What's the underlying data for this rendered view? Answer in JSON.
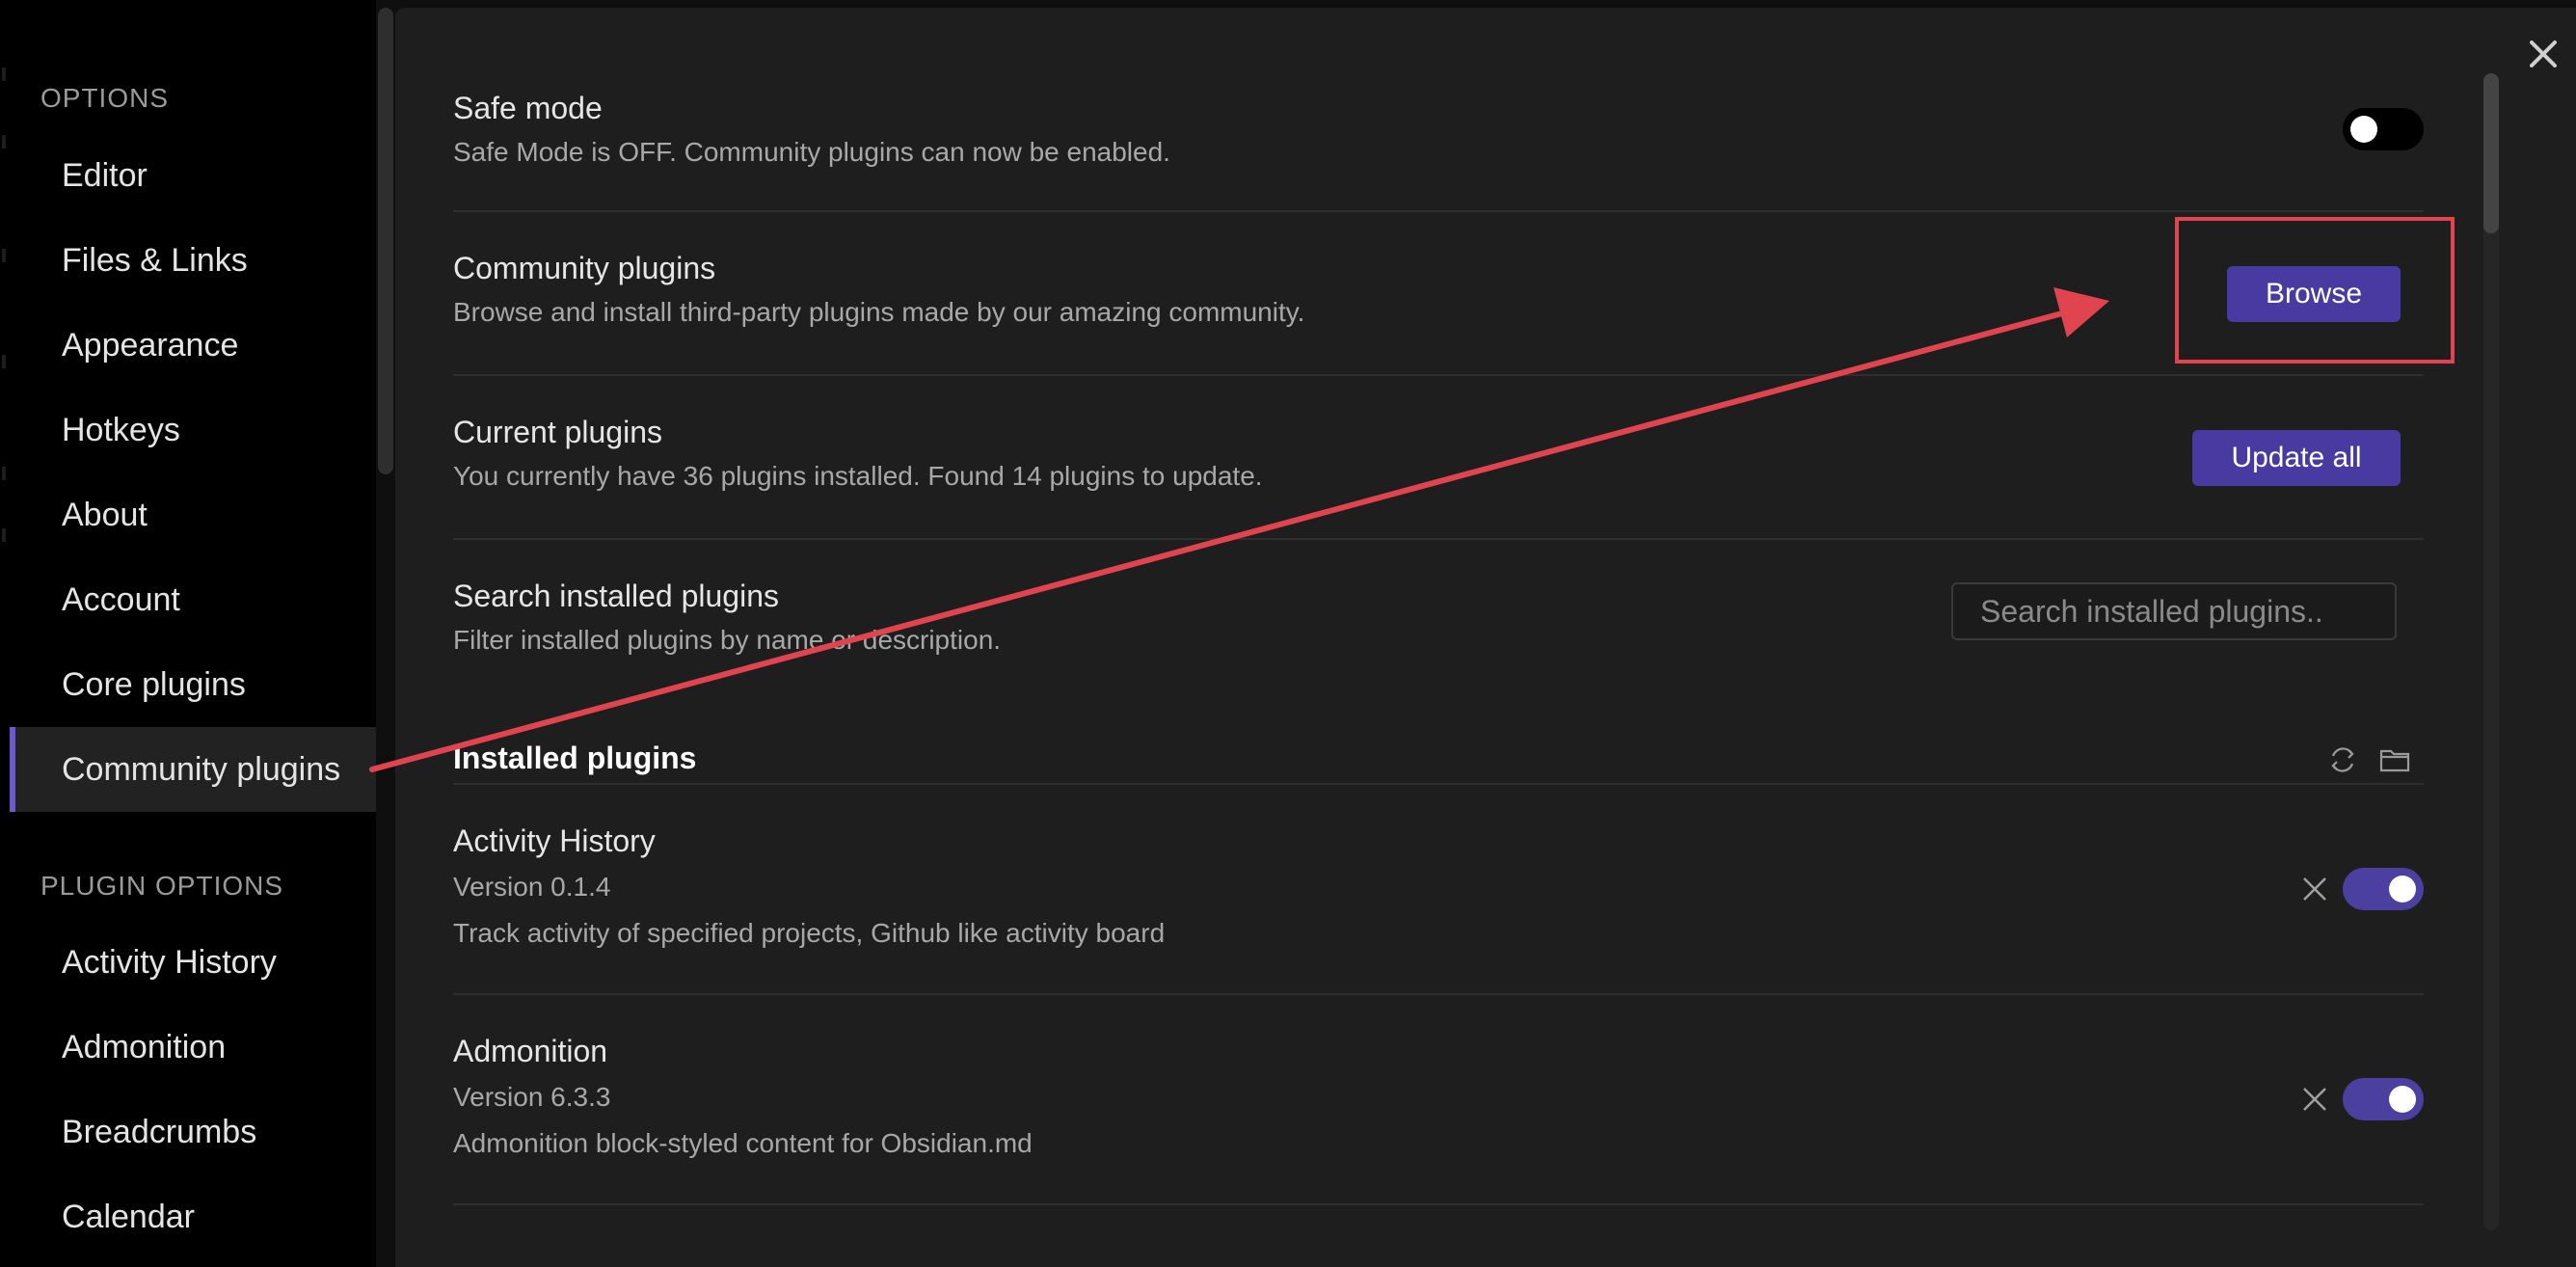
{
  "sidebar": {
    "options_header": "OPTIONS",
    "options_items": [
      {
        "label": "Editor"
      },
      {
        "label": "Files & Links"
      },
      {
        "label": "Appearance"
      },
      {
        "label": "Hotkeys"
      },
      {
        "label": "About"
      },
      {
        "label": "Account"
      },
      {
        "label": "Core plugins"
      },
      {
        "label": "Community plugins",
        "active": true
      }
    ],
    "plugin_options_header": "PLUGIN OPTIONS",
    "plugin_items": [
      {
        "label": "Activity History"
      },
      {
        "label": "Admonition"
      },
      {
        "label": "Breadcrumbs"
      },
      {
        "label": "Calendar"
      }
    ]
  },
  "main": {
    "safe_mode": {
      "name": "Safe mode",
      "desc": "Safe Mode is OFF. Community plugins can now be enabled.",
      "enabled": false
    },
    "community_plugins": {
      "name": "Community plugins",
      "desc": "Browse and install third-party plugins made by our amazing community.",
      "button": "Browse"
    },
    "current_plugins": {
      "name": "Current plugins",
      "desc": "You currently have 36 plugins installed. Found 14 plugins to update.",
      "button": "Update all"
    },
    "search_plugins": {
      "name": "Search installed plugins",
      "desc": "Filter installed plugins by name or description.",
      "placeholder": "Search installed plugins.."
    },
    "installed_header": "Installed plugins",
    "plugins": [
      {
        "name": "Activity History",
        "version": "Version 0.1.4",
        "desc": "Track activity of specified projects, Github like activity board",
        "enabled": true
      },
      {
        "name": "Admonition",
        "version": "Version 6.3.3",
        "desc": "Admonition block-styled content for Obsidian.md",
        "enabled": true
      }
    ]
  },
  "icons": {
    "close": "close-icon",
    "reload": "reload-icon",
    "folder": "folder-icon",
    "uninstall": "x-icon"
  },
  "colors": {
    "accent": "#483aa0",
    "annotation": "#e0454f",
    "toggle_on": "#4b3fa0"
  }
}
